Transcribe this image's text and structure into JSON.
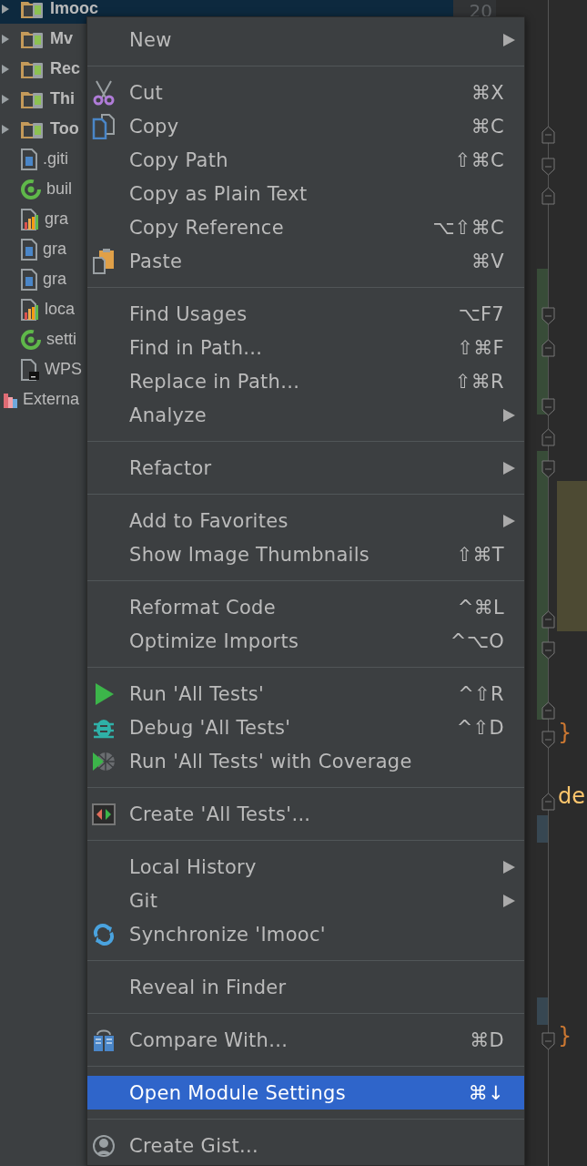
{
  "project_tree": {
    "items": [
      {
        "label": "Imooc",
        "kind": "module",
        "expanded": false,
        "selected": true
      },
      {
        "label": "Mv",
        "kind": "module",
        "expanded": false,
        "selected": false
      },
      {
        "label": "Rec",
        "kind": "module",
        "expanded": false,
        "selected": false
      },
      {
        "label": "Thi",
        "kind": "module",
        "expanded": false,
        "selected": false
      },
      {
        "label": "Too",
        "kind": "module",
        "expanded": false,
        "selected": false
      },
      {
        "label": ".giti",
        "kind": "text-file",
        "selected": false
      },
      {
        "label": "buil",
        "kind": "gradle-file",
        "selected": false
      },
      {
        "label": "gra",
        "kind": "properties-file",
        "selected": false
      },
      {
        "label": "gra",
        "kind": "text-file",
        "selected": false
      },
      {
        "label": "gra",
        "kind": "text-file",
        "selected": false
      },
      {
        "label": "loca",
        "kind": "properties-file",
        "selected": false
      },
      {
        "label": "setti",
        "kind": "gradle-file",
        "selected": false
      },
      {
        "label": "WPS",
        "kind": "script-file",
        "selected": false
      },
      {
        "label": "Externa",
        "kind": "library",
        "selected": false
      }
    ]
  },
  "editor": {
    "line_number": "20",
    "code": [
      {
        "text": "}",
        "kind": "brace"
      },
      {
        "text": "de",
        "kind": "keyword"
      },
      {
        "text": "}",
        "kind": "brace"
      }
    ]
  },
  "context_menu": {
    "groups": [
      {
        "items": [
          {
            "label": "New",
            "submenu": true,
            "selected": false
          }
        ]
      },
      {
        "items": [
          {
            "label": "Cut",
            "kind": "scissors",
            "shortcut": "⌘X",
            "submenu": false,
            "selected": false
          },
          {
            "label": "Copy",
            "kind": "copy",
            "shortcut": "⌘C",
            "submenu": false,
            "selected": false
          },
          {
            "label": "Copy Path",
            "shortcut": "⇧⌘C",
            "submenu": false,
            "selected": false
          },
          {
            "label": "Copy as Plain Text",
            "submenu": false,
            "selected": false
          },
          {
            "label": "Copy Reference",
            "shortcut": "⌥⇧⌘C",
            "submenu": false,
            "selected": false
          },
          {
            "label": "Paste",
            "kind": "paste",
            "shortcut": "⌘V",
            "submenu": false,
            "selected": false
          }
        ]
      },
      {
        "items": [
          {
            "label": "Find Usages",
            "shortcut": "⌥F7",
            "submenu": false,
            "selected": false
          },
          {
            "label": "Find in Path...",
            "shortcut": "⇧⌘F",
            "submenu": false,
            "selected": false
          },
          {
            "label": "Replace in Path...",
            "shortcut": "⇧⌘R",
            "submenu": false,
            "selected": false
          },
          {
            "label": "Analyze",
            "submenu": true,
            "selected": false
          }
        ]
      },
      {
        "items": [
          {
            "label": "Refactor",
            "submenu": true,
            "selected": false
          }
        ]
      },
      {
        "items": [
          {
            "label": "Add to Favorites",
            "submenu": true,
            "selected": false
          },
          {
            "label": "Show Image Thumbnails",
            "shortcut": "⇧⌘T",
            "submenu": false,
            "selected": false
          }
        ]
      },
      {
        "items": [
          {
            "label": "Reformat Code",
            "shortcut": "^⌘L",
            "submenu": false,
            "selected": false
          },
          {
            "label": "Optimize Imports",
            "shortcut": "^⌥O",
            "submenu": false,
            "selected": false
          }
        ]
      },
      {
        "items": [
          {
            "label": "Run 'All Tests'",
            "kind": "run",
            "shortcut": "^⇧R",
            "submenu": false,
            "selected": false
          },
          {
            "label": "Debug 'All Tests'",
            "kind": "debug",
            "shortcut": "^⇧D",
            "submenu": false,
            "selected": false
          },
          {
            "label": "Run 'All Tests' with Coverage",
            "kind": "coverage",
            "submenu": false,
            "selected": false
          }
        ]
      },
      {
        "items": [
          {
            "label": "Create 'All Tests'...",
            "kind": "create-test",
            "submenu": false,
            "selected": false
          }
        ]
      },
      {
        "items": [
          {
            "label": "Local History",
            "submenu": true,
            "selected": false
          },
          {
            "label": "Git",
            "submenu": true,
            "selected": false
          },
          {
            "label": "Synchronize 'Imooc'",
            "kind": "sync",
            "submenu": false,
            "selected": false
          }
        ]
      },
      {
        "items": [
          {
            "label": "Reveal in Finder",
            "submenu": false,
            "selected": false
          }
        ]
      },
      {
        "items": [
          {
            "label": "Compare With...",
            "kind": "compare",
            "shortcut": "⌘D",
            "submenu": false,
            "selected": false
          }
        ]
      },
      {
        "items": [
          {
            "label": "Open Module Settings",
            "shortcut": "⌘↓",
            "submenu": false,
            "selected": true
          }
        ]
      },
      {
        "items": [
          {
            "label": "Create Gist...",
            "kind": "gist",
            "submenu": false,
            "selected": false
          }
        ]
      }
    ]
  }
}
